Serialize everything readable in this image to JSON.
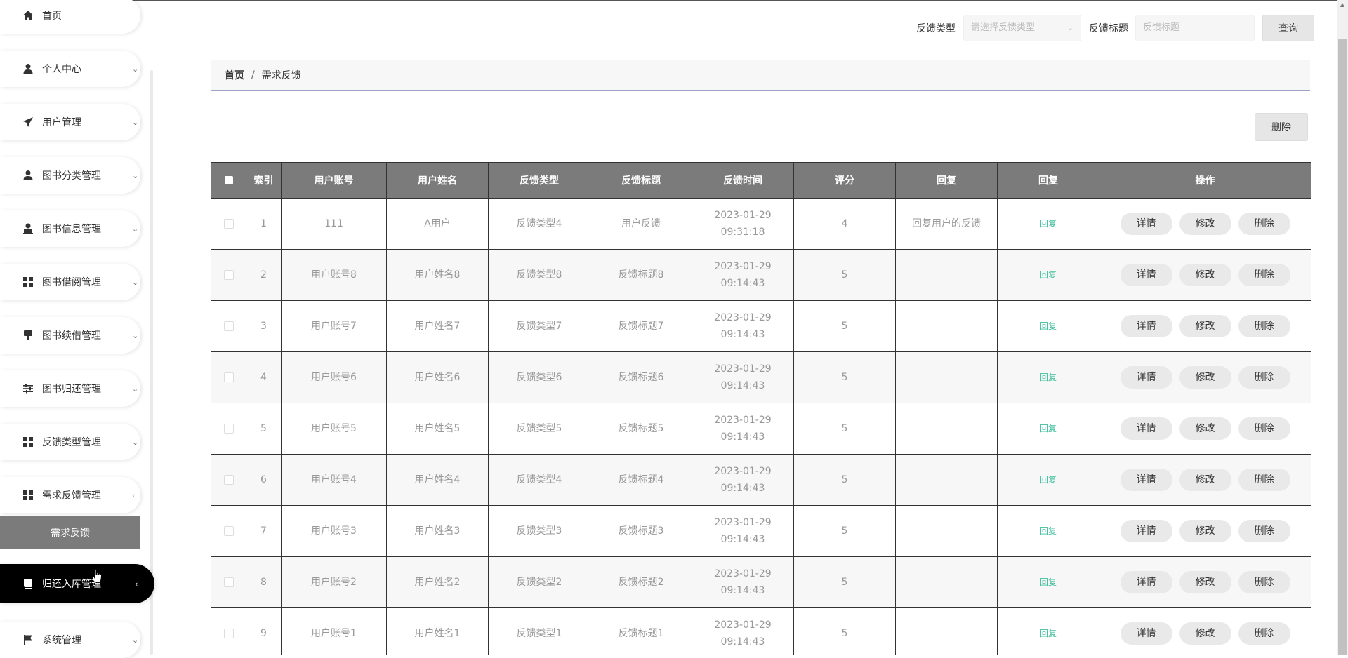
{
  "sidebar": {
    "items": [
      {
        "label": "首页",
        "icon": "home-icon"
      },
      {
        "label": "个人中心",
        "icon": "user-icon",
        "arrow": "⌄"
      },
      {
        "label": "用户管理",
        "icon": "send-icon",
        "arrow": "⌄"
      },
      {
        "label": "图书分类管理",
        "icon": "user-icon",
        "arrow": "⌄"
      },
      {
        "label": "图书信息管理",
        "icon": "person-icon",
        "arrow": "⌄"
      },
      {
        "label": "图书借阅管理",
        "icon": "grid-icon",
        "arrow": "⌄"
      },
      {
        "label": "图书续借管理",
        "icon": "brush-icon",
        "arrow": "⌄"
      },
      {
        "label": "图书归还管理",
        "icon": "sliders-icon",
        "arrow": "⌄"
      },
      {
        "label": "反馈类型管理",
        "icon": "grid-icon",
        "arrow": "⌄"
      },
      {
        "label": "需求反馈管理",
        "icon": "grid-icon",
        "arrow": "‹"
      },
      {
        "label": "归还入库管理",
        "icon": "book-icon",
        "arrow": "‹"
      },
      {
        "label": "系统管理",
        "icon": "flag-icon",
        "arrow": "⌄"
      }
    ],
    "submenu_label": "需求反馈"
  },
  "search": {
    "type_label": "反馈类型",
    "type_placeholder": "请选择反馈类型",
    "title_label": "反馈标题",
    "title_placeholder": "反馈标题",
    "query_label": "查询"
  },
  "breadcrumb": {
    "home": "首页",
    "separator": "/",
    "current": "需求反馈"
  },
  "toolbar": {
    "delete_label": "删除"
  },
  "table": {
    "headers": [
      "索引",
      "用户账号",
      "用户姓名",
      "反馈类型",
      "反馈标题",
      "反馈时间",
      "评分",
      "回复",
      "回复",
      "操作"
    ],
    "reply_link": "回复",
    "actions": [
      "详情",
      "修改",
      "删除"
    ],
    "rows": [
      {
        "index": "1",
        "account": "111",
        "name": "A用户",
        "type": "反馈类型4",
        "title": "用户反馈",
        "time": "2023-01-29 09:31:18",
        "score": "4",
        "reply": "回复用户的反馈"
      },
      {
        "index": "2",
        "account": "用户账号8",
        "name": "用户姓名8",
        "type": "反馈类型8",
        "title": "反馈标题8",
        "time": "2023-01-29 09:14:43",
        "score": "5",
        "reply": ""
      },
      {
        "index": "3",
        "account": "用户账号7",
        "name": "用户姓名7",
        "type": "反馈类型7",
        "title": "反馈标题7",
        "time": "2023-01-29 09:14:43",
        "score": "5",
        "reply": ""
      },
      {
        "index": "4",
        "account": "用户账号6",
        "name": "用户姓名6",
        "type": "反馈类型6",
        "title": "反馈标题6",
        "time": "2023-01-29 09:14:43",
        "score": "5",
        "reply": ""
      },
      {
        "index": "5",
        "account": "用户账号5",
        "name": "用户姓名5",
        "type": "反馈类型5",
        "title": "反馈标题5",
        "time": "2023-01-29 09:14:43",
        "score": "5",
        "reply": ""
      },
      {
        "index": "6",
        "account": "用户账号4",
        "name": "用户姓名4",
        "type": "反馈类型4",
        "title": "反馈标题4",
        "time": "2023-01-29 09:14:43",
        "score": "5",
        "reply": ""
      },
      {
        "index": "7",
        "account": "用户账号3",
        "name": "用户姓名3",
        "type": "反馈类型3",
        "title": "反馈标题3",
        "time": "2023-01-29 09:14:43",
        "score": "5",
        "reply": ""
      },
      {
        "index": "8",
        "account": "用户账号2",
        "name": "用户姓名2",
        "type": "反馈类型2",
        "title": "反馈标题2",
        "time": "2023-01-29 09:14:43",
        "score": "5",
        "reply": ""
      },
      {
        "index": "9",
        "account": "用户账号1",
        "name": "用户姓名1",
        "type": "反馈类型1",
        "title": "反馈标题1",
        "time": "2023-01-29 09:14:43",
        "score": "5",
        "reply": ""
      }
    ]
  },
  "colors": {
    "reply_link": "#3fbf9b",
    "header_bg": "#7b7b7b",
    "active_menu_bg": "#000000"
  }
}
